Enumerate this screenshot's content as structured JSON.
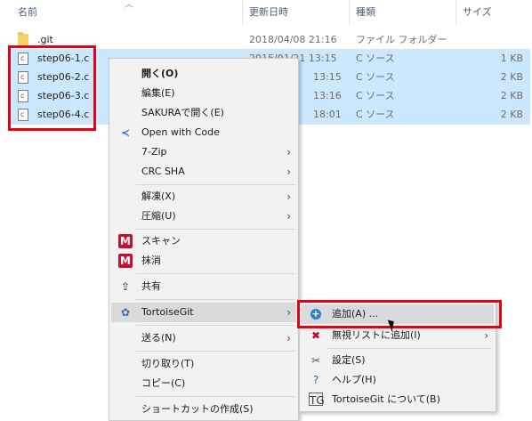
{
  "columns": {
    "name": "名前",
    "date": "更新日時",
    "type": "種類",
    "size": "サイズ"
  },
  "files": [
    {
      "name": ".git",
      "date": "2018/04/08 21:16",
      "type": "ファイル フォルダー",
      "size": "",
      "icon": "folder-icon",
      "selected": false
    },
    {
      "name": "step06-1.c",
      "date": "2015/01/21 13:15",
      "type": "C ソース",
      "size": "1 KB",
      "icon": "c-file-icon",
      "selected": true
    },
    {
      "name": "step06-2.c",
      "date": "13:15",
      "type": "C ソース",
      "size": "2 KB",
      "icon": "c-file-icon",
      "selected": true
    },
    {
      "name": "step06-3.c",
      "date": "13:16",
      "type": "C ソース",
      "size": "2 KB",
      "icon": "c-file-icon",
      "selected": true
    },
    {
      "name": "step06-4.c",
      "date": "18:01",
      "type": "C ソース",
      "size": "2 KB",
      "icon": "c-file-icon",
      "selected": true
    }
  ],
  "context_menu": {
    "items": [
      {
        "label": "開く(O)",
        "bold": true
      },
      {
        "label": "編集(E)"
      },
      {
        "label": "SAKURAで開く(E)"
      },
      {
        "label": "Open with Code",
        "icon": "vscode-icon"
      },
      {
        "label": "7-Zip",
        "submenu": true
      },
      {
        "label": "CRC SHA",
        "submenu": true
      },
      {
        "label": "解凍(X)",
        "submenu": true
      },
      {
        "label": "圧縮(U)",
        "submenu": true
      },
      {
        "label": "スキャン",
        "icon": "mcafee-icon"
      },
      {
        "label": "抹消",
        "icon": "mcafee-icon"
      },
      {
        "label": "共有",
        "icon": "share-icon"
      },
      {
        "label": "TortoiseGit",
        "submenu": true,
        "icon": "tortoisegit-icon"
      },
      {
        "label": "送る(N)",
        "submenu": true
      },
      {
        "label": "切り取り(T)"
      },
      {
        "label": "コピー(C)"
      },
      {
        "label": "ショートカットの作成(S)"
      }
    ]
  },
  "tortoise_submenu": {
    "items": [
      {
        "label": "追加(A) ...",
        "icon": "add-icon"
      },
      {
        "label": "無視リストに追加(I)",
        "submenu": true,
        "icon": "ignore-icon"
      },
      {
        "label": "設定(S)",
        "icon": "settings-icon"
      },
      {
        "label": "ヘルプ(H)",
        "icon": "help-icon"
      },
      {
        "label": "TortoiseGit について(B)",
        "icon": "about-icon"
      }
    ]
  },
  "colors": {
    "selection": "#cce8ff",
    "highlight_box": "#e60012",
    "menu_bg": "#f2f2f2"
  }
}
